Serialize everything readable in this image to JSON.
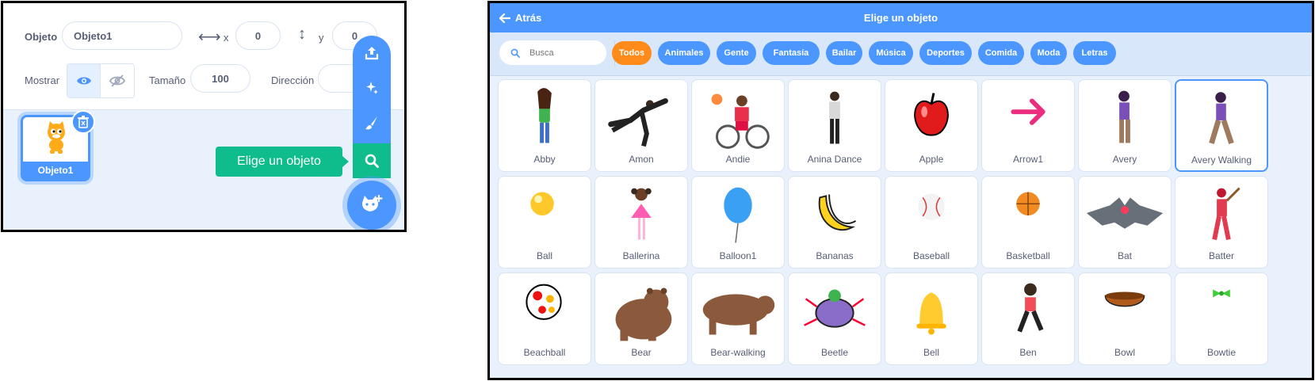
{
  "sprite_info": {
    "sprite_label": "Objeto",
    "sprite_name": "Objeto1",
    "x_label": "x",
    "x_value": "0",
    "y_label": "y",
    "y_value": "0",
    "show_label": "Mostrar",
    "size_label": "Tamaño",
    "size_value": "100",
    "direction_label": "Dirección"
  },
  "sprite_tile": {
    "name": "Objeto1"
  },
  "tooltip": "Elige un objeto",
  "sprite_menu": {
    "items": [
      "upload-icon",
      "surprise-icon",
      "paint-icon",
      "search-icon"
    ],
    "main": "cat-add-icon",
    "accent": "#4c97ff",
    "selected_color": "#0fbd8c"
  },
  "library": {
    "back": "Atrás",
    "title": "Elige un objeto",
    "search_placeholder": "Busca",
    "tags": [
      "Todos",
      "Animales",
      "Gente",
      "Fantasía",
      "Bailar",
      "Música",
      "Deportes",
      "Comida",
      "Moda",
      "Letras"
    ],
    "active_tag": "Todos",
    "active_color": "#ff8c1a",
    "sprites": [
      "Abby",
      "Amon",
      "Andie",
      "Anina Dance",
      "Apple",
      "Arrow1",
      "Avery",
      "Avery Walking",
      "Ball",
      "Ballerina",
      "Balloon1",
      "Bananas",
      "Baseball",
      "Basketball",
      "Bat",
      "Batter",
      "Beachball",
      "Bear",
      "Bear-walking",
      "Beetle",
      "Bell",
      "Ben",
      "Bowl",
      "Bowtie"
    ]
  }
}
